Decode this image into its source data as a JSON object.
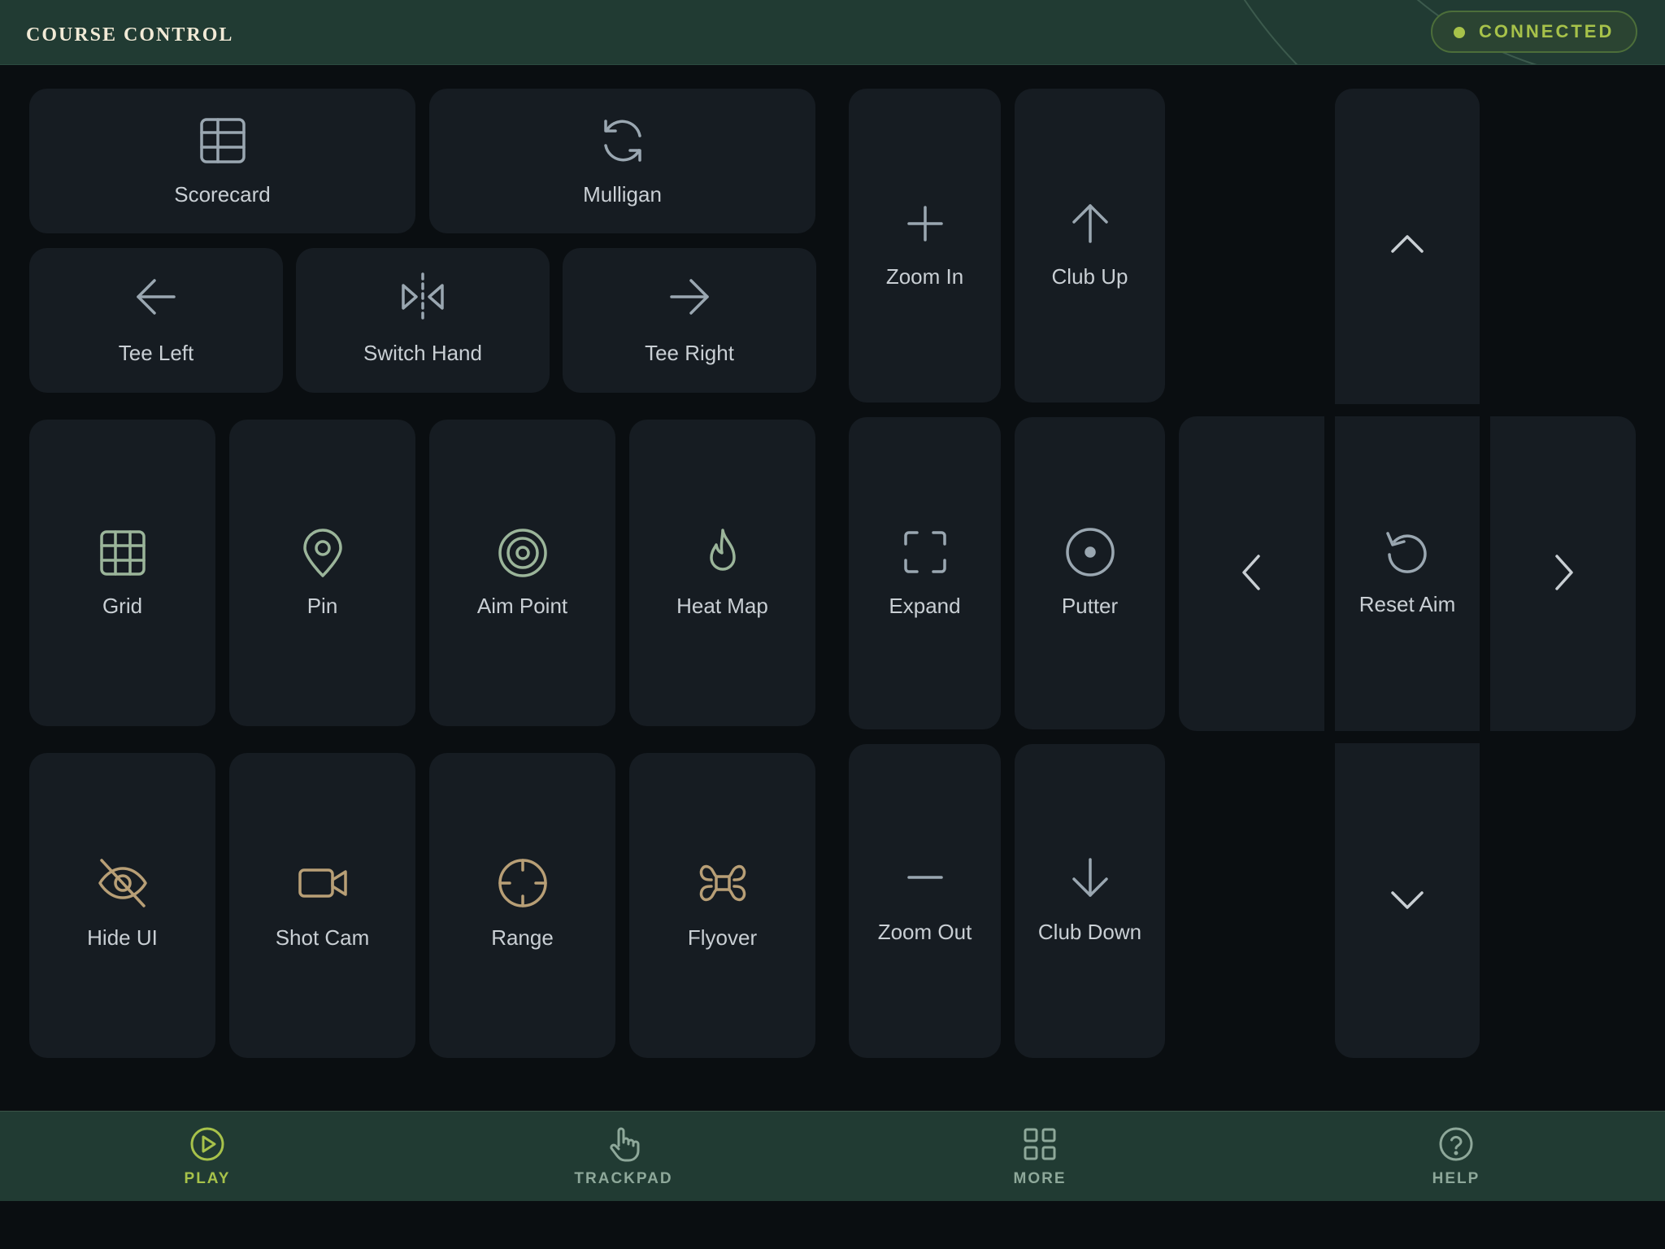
{
  "header": {
    "title": "COURSE CONTROL",
    "status": "CONNECTED",
    "status_color": "#a7c24a"
  },
  "controls": {
    "scorecard": {
      "label": "Scorecard",
      "icon": "table-icon"
    },
    "mulligan": {
      "label": "Mulligan",
      "icon": "refresh-icon"
    },
    "tee_left": {
      "label": "Tee Left",
      "icon": "arrow-left-icon"
    },
    "switch_hand": {
      "label": "Switch Hand",
      "icon": "flip-horizontal-icon"
    },
    "tee_right": {
      "label": "Tee Right",
      "icon": "arrow-right-icon"
    },
    "grid": {
      "label": "Grid",
      "icon": "grid-icon"
    },
    "pin": {
      "label": "Pin",
      "icon": "map-pin-icon"
    },
    "aim_point": {
      "label": "Aim Point",
      "icon": "target-icon"
    },
    "heat_map": {
      "label": "Heat Map",
      "icon": "flame-icon"
    },
    "hide_ui": {
      "label": "Hide UI",
      "icon": "eye-off-icon"
    },
    "shot_cam": {
      "label": "Shot Cam",
      "icon": "video-camera-icon"
    },
    "range": {
      "label": "Range",
      "icon": "crosshair-icon"
    },
    "flyover": {
      "label": "Flyover",
      "icon": "drone-icon"
    },
    "zoom_in": {
      "label": "Zoom In",
      "icon": "plus-icon"
    },
    "club_up": {
      "label": "Club Up",
      "icon": "arrow-up-icon"
    },
    "expand": {
      "label": "Expand",
      "icon": "expand-icon"
    },
    "putter": {
      "label": "Putter",
      "icon": "disc-icon"
    },
    "zoom_out": {
      "label": "Zoom Out",
      "icon": "minus-icon"
    },
    "club_down": {
      "label": "Club Down",
      "icon": "arrow-down-icon"
    },
    "reset_aim": {
      "label": "Reset Aim",
      "icon": "rotate-ccw-icon"
    }
  },
  "dpad": {
    "up_icon": "chevron-up-icon",
    "down_icon": "chevron-down-icon",
    "left_icon": "chevron-left-icon",
    "right_icon": "chevron-right-icon"
  },
  "colors": {
    "header_bg": "#213b33",
    "tile_bg": "#161c22",
    "icon_gray": "#9aa7b1",
    "icon_green": "#9bb59a",
    "icon_tan": "#b89f76",
    "accent": "#a7c24a"
  },
  "nav": {
    "active": "play",
    "items": [
      {
        "id": "play",
        "label": "PLAY",
        "icon": "play-circle-icon"
      },
      {
        "id": "trackpad",
        "label": "TRACKPAD",
        "icon": "pointer-hand-icon"
      },
      {
        "id": "more",
        "label": "MORE",
        "icon": "apps-icon"
      },
      {
        "id": "help",
        "label": "HELP",
        "icon": "help-circle-icon"
      }
    ]
  }
}
